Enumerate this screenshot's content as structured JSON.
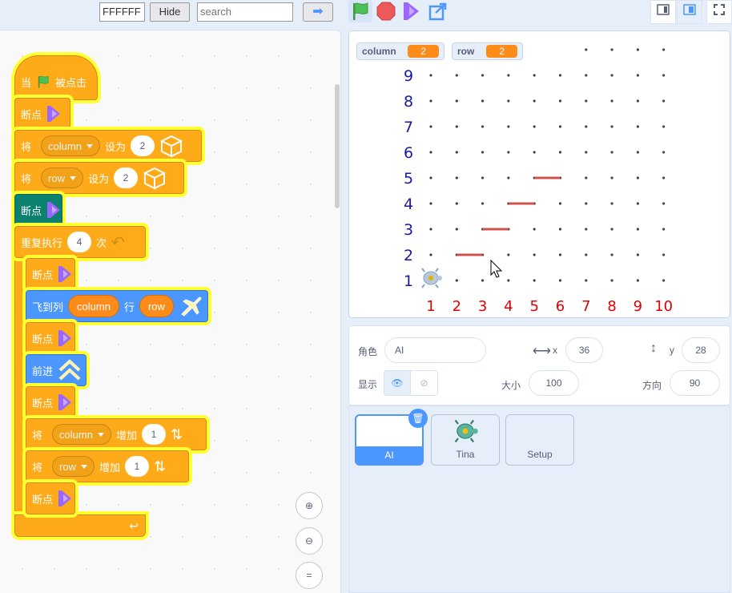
{
  "toolbar": {
    "hex_value": "FFFFFF",
    "hide_label": "Hide",
    "search_placeholder": "search",
    "go_icon": "arrow-right-icon"
  },
  "controls": {
    "green_flag": "green-flag-icon",
    "stop": "stop-icon",
    "step": "breakpoint-step-icon",
    "share": "share-icon"
  },
  "view_buttons": [
    "small-stage-icon",
    "normal-stage-icon",
    "fullscreen-icon"
  ],
  "blocks": {
    "hat_when": "当",
    "hat_clicked": "被点击",
    "breakpoint": "断点",
    "set_prefix": "将",
    "set_to": "设为",
    "var_column": "column",
    "var_row": "row",
    "val_2a": "2",
    "val_2b": "2",
    "repeat": "重复执行",
    "repeat_count": "4",
    "repeat_times": "次",
    "goto": "飞到列",
    "goto_row": "行",
    "goto_col_var": "column",
    "goto_row_var": "row",
    "forward": "前进",
    "change_prefix": "将",
    "change_by": "增加",
    "inc_a": "1",
    "inc_b": "1"
  },
  "stage": {
    "monitors": [
      {
        "label": "column",
        "value": "2"
      },
      {
        "label": "row",
        "value": "2"
      }
    ],
    "row_labels": [
      "9",
      "8",
      "7",
      "6",
      "5",
      "4",
      "3",
      "2",
      "1"
    ],
    "col_labels": [
      "1",
      "2",
      "3",
      "4",
      "5",
      "6",
      "7",
      "8",
      "9",
      "10"
    ],
    "segments": [
      {
        "col": 2,
        "row": 2
      },
      {
        "col": 3,
        "row": 3
      },
      {
        "col": 4,
        "row": 4
      },
      {
        "col": 5,
        "row": 5
      }
    ],
    "row_label_color": "#1a1aa0",
    "col_label_color": "#e00000",
    "segment_color": "#d0504a"
  },
  "sprite_info": {
    "sprite_label": "角色",
    "sprite_name": "AI",
    "x_label": "x",
    "x_value": "36",
    "y_label": "y",
    "y_value": "28",
    "show_label": "显示",
    "size_label": "大小",
    "size_value": "100",
    "dir_label": "方向",
    "dir_value": "90"
  },
  "sprites": [
    {
      "name": "AI",
      "selected": true
    },
    {
      "name": "Tina",
      "selected": false
    },
    {
      "name": "Setup",
      "selected": false
    }
  ],
  "zoom": {
    "in": "zoom-in-icon",
    "out": "zoom-out-icon",
    "reset": "="
  }
}
